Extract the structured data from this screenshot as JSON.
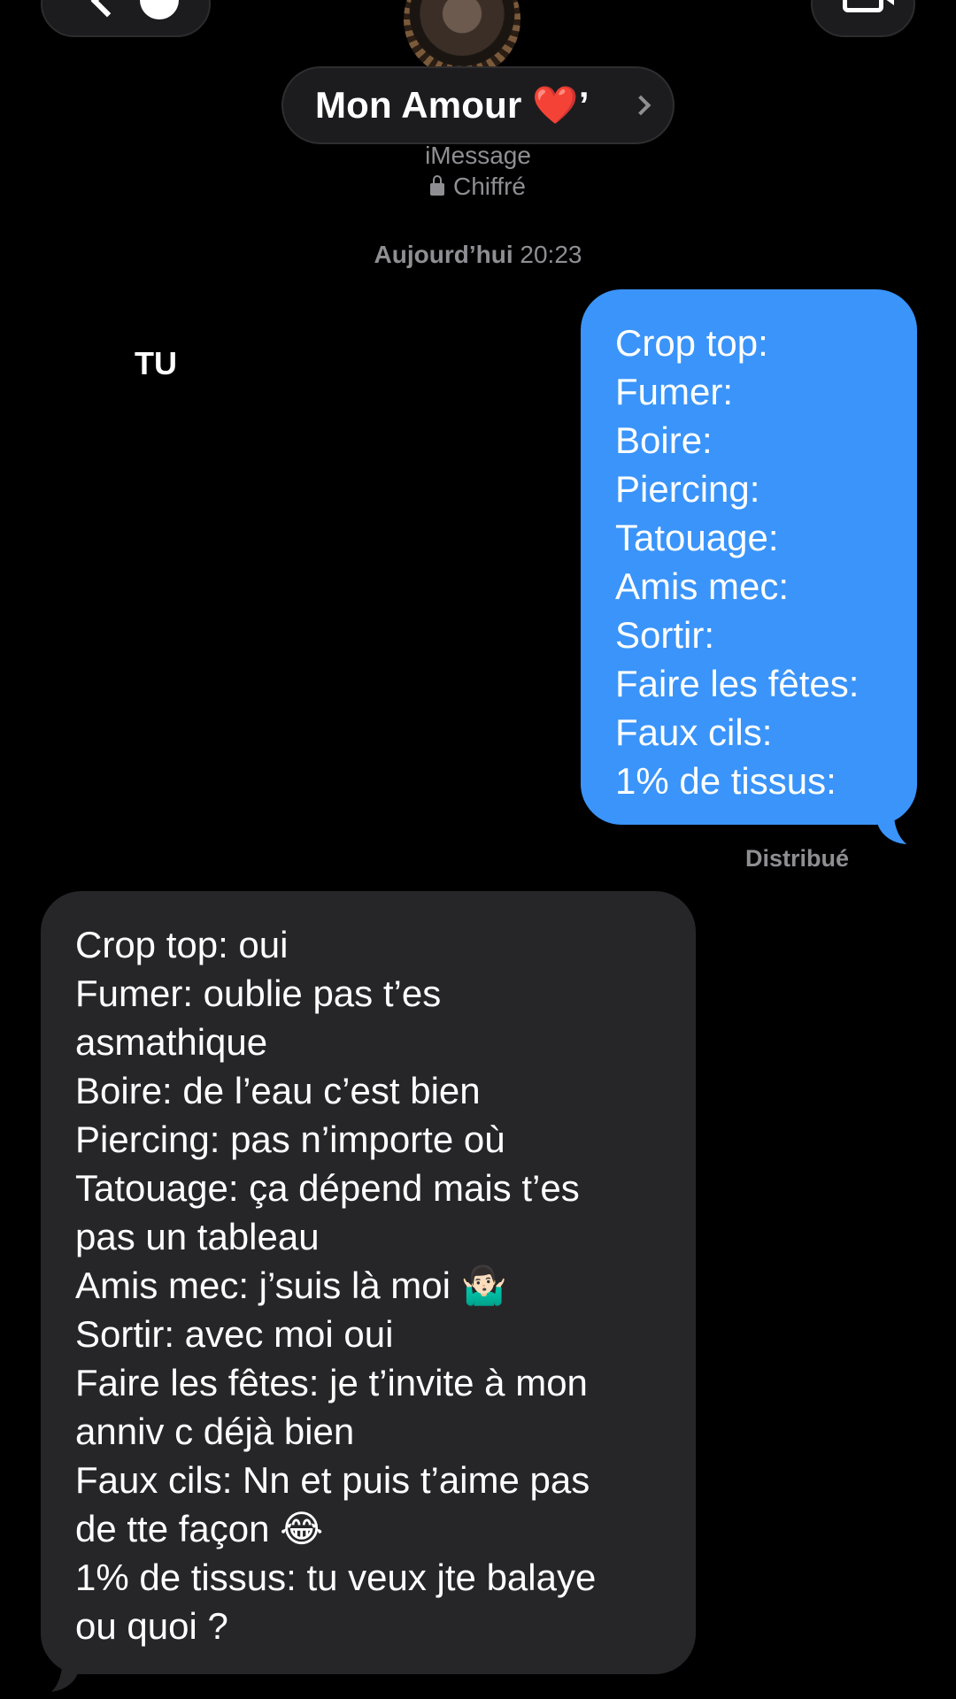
{
  "header": {
    "contact_name": "Mon Amour ❤️’",
    "service": "iMessage",
    "encryption": "Chiffré",
    "icons": [
      "chevron-left-icon",
      "video-camera-icon",
      "lock-icon",
      "chevron-right-icon"
    ]
  },
  "thread": {
    "timestamp_day": "Aujourd’hui",
    "timestamp_time": "20:23",
    "side_label": "TU",
    "sent_status": "Distribué",
    "sent_message": {
      "lines": [
        "Crop top:",
        "Fumer:",
        "Boire:",
        "Piercing:",
        "Tatouage:",
        "Amis mec:",
        "Sortir:",
        "Faire les fêtes:",
        "Faux cils:",
        "1% de tissus:"
      ]
    },
    "received_message": {
      "lines": [
        "Crop top: oui",
        "Fumer: oublie pas t’es",
        "asmathique",
        "Boire: de l’eau c’est bien",
        "Piercing: pas n’importe où",
        "Tatouage: ça dépend mais t’es",
        "pas un tableau",
        "Amis mec: j’suis là moi 🤷🏻‍♂️",
        "Sortir: avec moi oui",
        "Faire les fêtes: je t’invite à mon",
        "anniv c déjà bien",
        "Faux cils: Nn et puis t’aime pas",
        "de tte façon 😂",
        "1% de tissus: tu veux jte balaye",
        "ou quoi ?"
      ]
    }
  },
  "colors": {
    "background": "#000000",
    "sent_bubble": "#3a94fa",
    "received_bubble": "#262629",
    "secondary_text": "#8e8e93"
  }
}
